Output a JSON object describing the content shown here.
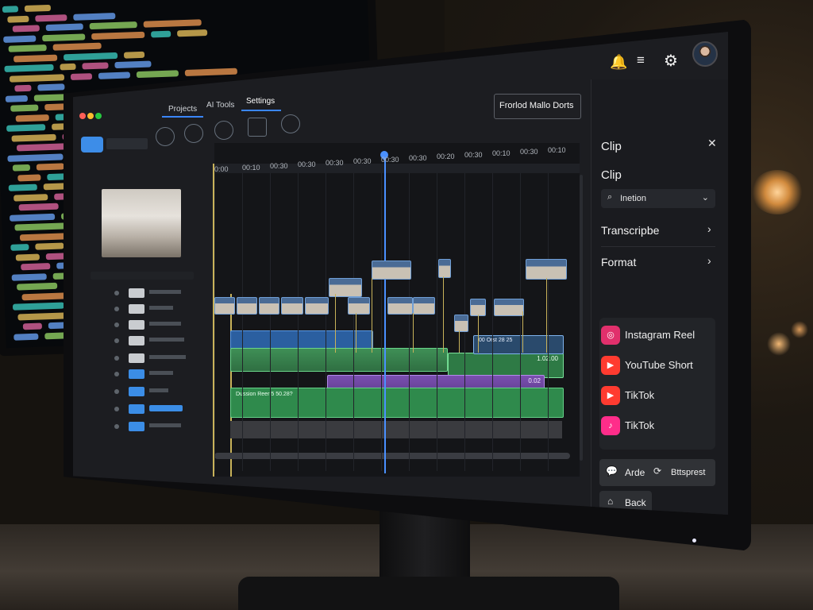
{
  "top_bar": {
    "bell_icon": "bell-icon",
    "menu_icon": "sort-icon",
    "gear_icon": "gear-icon"
  },
  "nav": {
    "tabs": [
      "Projects",
      "AI Tools",
      "Settings"
    ],
    "active_tab": "Settings"
  },
  "header_button": {
    "label": "Frorlod Mallo Dorts"
  },
  "timeline": {
    "ruler": [
      "0:00",
      "00:10",
      "00:30",
      "00:30",
      "00:30",
      "00:30",
      "00:30",
      "00:30",
      "00:20",
      "00:30",
      "00:10",
      "00:30",
      "00:10"
    ],
    "clip_labels": [
      "00 Orst 28 25",
      "1.02.00",
      "0.02",
      "Dussion Reer 5 50.28?"
    ]
  },
  "panel": {
    "title": "Clip",
    "subtitle": "Clip",
    "dropdown_value": "Inetion",
    "transcribe_label": "Transcripbe",
    "format_label": "Format",
    "formats": [
      {
        "label": "Instagram Reel",
        "icon": "instagram-icon",
        "color": "#e1306c"
      },
      {
        "label": "YouTube Short",
        "icon": "youtube-icon",
        "color": "#ff3b30"
      },
      {
        "label": "TikTok",
        "icon": "youtube-icon",
        "color": "#ff3b30"
      },
      {
        "label": "TikTok",
        "icon": "tiktok-icon",
        "color": "#ff2d8a"
      }
    ],
    "bottom_left_label": "Arde",
    "bottom_right_label": "Bttsprest",
    "back_label": "Back"
  },
  "colors": {
    "accent": "#3a86ff",
    "panel_bg": "#1a1b1f",
    "timeline_bg": "#141518"
  }
}
